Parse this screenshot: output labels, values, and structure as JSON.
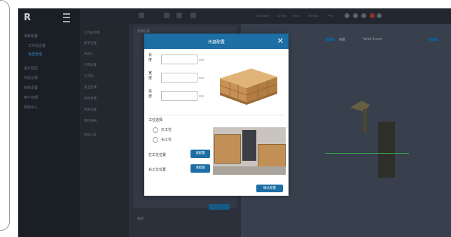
{
  "app": {
    "logo": "R"
  },
  "sidebar": {
    "items": [
      {
        "label": "场景配置",
        "active": false
      },
      {
        "label": "工作站设置",
        "active": true
      },
      {
        "label": "垛型管理",
        "active": false
      },
      {
        "label": "运行监控",
        "active": false
      },
      {
        "label": "日志记录",
        "active": false
      },
      {
        "label": "系统设置",
        "active": false
      },
      {
        "label": "用户管理",
        "active": false
      },
      {
        "label": "帮助中心",
        "active": false
      }
    ]
  },
  "topbar": {
    "links": [
      "Standard",
      "Online",
      "Help",
      "Version",
      "中文"
    ]
  },
  "panel2": {
    "items": [
      "工作站参数",
      "抓手设置",
      "机器人",
      "示教设置",
      "工作流",
      "安全区域",
      "码垛参数",
      "托盘设置",
      "物料规格",
      "调试工具"
    ]
  },
  "main": {
    "label1": "参数设置",
    "label2": "编辑"
  },
  "canvas": {
    "tab1": "视图",
    "tab2": "Pallet Scene"
  },
  "modal": {
    "title": "托盘配置",
    "close_glyph": "✕",
    "dims": [
      {
        "label": "长度",
        "value": "",
        "unit": "mm"
      },
      {
        "label": "宽度",
        "value": "",
        "unit": "mm"
      },
      {
        "label": "高度",
        "value": "",
        "unit": "mm"
      }
    ],
    "section_title": "工位选择",
    "radios": [
      {
        "label": "左工位",
        "checked": false
      },
      {
        "label": "右工位",
        "checked": false
      }
    ],
    "config_rows": [
      {
        "label": "左工位位置",
        "button": "请配置"
      },
      {
        "label": "右工位位置",
        "button": "请配置"
      }
    ],
    "confirm": "确认配置"
  },
  "colors": {
    "primary": "#1c6ea5",
    "sidebar_bg": "#20252e",
    "app_bg": "#3a4150"
  }
}
